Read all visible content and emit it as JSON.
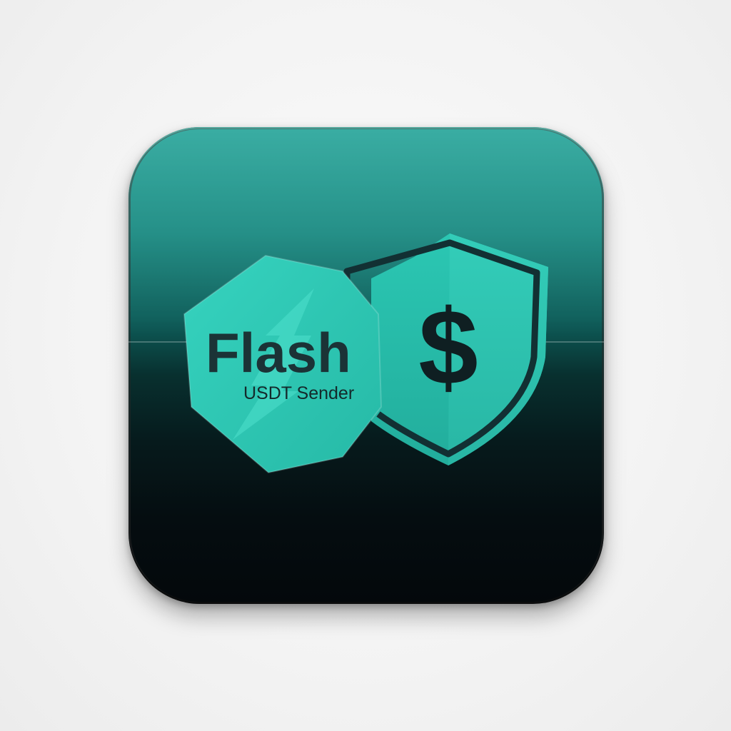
{
  "icon": {
    "title": "Flash",
    "subtitle": "USDT Sender",
    "currency_symbol": "$",
    "icons": [
      "hexagon-badge-icon",
      "lightning-bolt-icon",
      "shield-icon",
      "dollar-sign-icon"
    ]
  },
  "colors": {
    "accent": "#2ec9b4",
    "accent_light": "#3fd6c2",
    "dark": "#04080b",
    "text_dark": "#1b3336"
  }
}
